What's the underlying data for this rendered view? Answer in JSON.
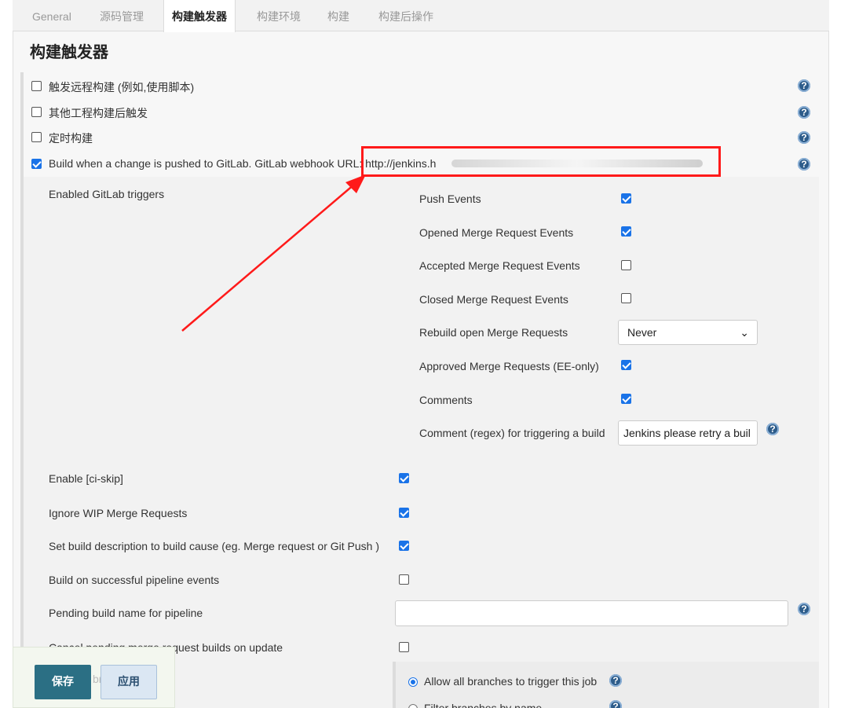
{
  "tabs": [
    {
      "label": "General"
    },
    {
      "label": "源码管理"
    },
    {
      "label": "构建触发器"
    },
    {
      "label": "构建环境"
    },
    {
      "label": "构建"
    },
    {
      "label": "构建后操作"
    }
  ],
  "section_title": "构建触发器",
  "triggers": [
    {
      "label": "触发远程构建 (例如,使用脚本)",
      "checked": false
    },
    {
      "label": "其他工程构建后触发",
      "checked": false
    },
    {
      "label": "定时构建",
      "checked": false
    },
    {
      "label": "Build when a change is pushed to GitLab. GitLab webhook URL: http://jenkins.h",
      "checked": true
    }
  ],
  "gitlab_triggers": {
    "label": "Enabled GitLab triggers",
    "options": [
      {
        "label": "Push Events",
        "checked": true
      },
      {
        "label": "Opened Merge Request Events",
        "checked": true
      },
      {
        "label": "Accepted Merge Request Events",
        "checked": false
      },
      {
        "label": "Closed Merge Request Events",
        "checked": false
      },
      {
        "label": "Rebuild open Merge Requests",
        "select_value": "Never"
      },
      {
        "label": "Approved Merge Requests (EE-only)",
        "checked": true
      },
      {
        "label": "Comments",
        "checked": true
      },
      {
        "label": "Comment (regex) for triggering a build",
        "input_value": "Jenkins please retry a buil"
      }
    ]
  },
  "advanced_options": [
    {
      "label": "Enable [ci-skip]",
      "checked": true
    },
    {
      "label": "Ignore WIP Merge Requests",
      "checked": true
    },
    {
      "label": "Set build description to build cause (eg. Merge request or Git Push )",
      "checked": true
    },
    {
      "label": "Build on successful pipeline events",
      "checked": false
    },
    {
      "label": "Pending build name for pipeline",
      "input_value": ""
    },
    {
      "label": "Cancel pending merge request builds on update",
      "checked": false
    }
  ],
  "branch_filter": {
    "options": [
      {
        "label": "Allow all branches to trigger this job",
        "selected": true
      },
      {
        "label": "Filter branches by name",
        "selected": false
      }
    ]
  },
  "footer": {
    "save_label": "保存",
    "apply_label": "应用",
    "partial_label": "br"
  },
  "help_glyph": "?",
  "select_chevron": "⌄",
  "colors": {
    "accent": "#1a73e8",
    "annotation_red": "#ff1a1a",
    "help_icon": "#2d5c8a",
    "save_button": "#2b6f84"
  }
}
